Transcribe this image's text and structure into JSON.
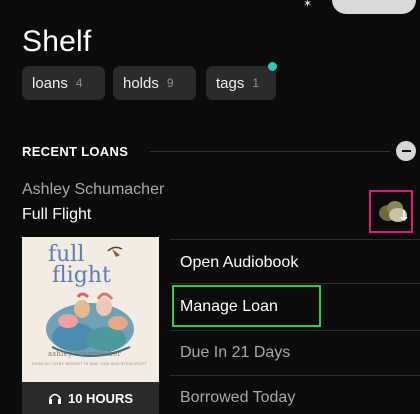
{
  "page": {
    "title": "Shelf"
  },
  "filters": [
    {
      "label": "loans",
      "count": "4"
    },
    {
      "label": "holds",
      "count": "9"
    },
    {
      "label": "tags",
      "count": "1"
    }
  ],
  "section": {
    "header": "RECENT LOANS"
  },
  "loan": {
    "author": "Ashley Schumacher",
    "title": "Full Flight",
    "cover": {
      "title_line1": "full",
      "title_line2": "flight",
      "author": "ashley schumacher",
      "credit": "READ BY COBY BENNETTS AND TINA WOLSTENCROFT"
    },
    "duration": "10 HOURS"
  },
  "menu": {
    "items": [
      "Open Audiobook",
      "Manage Loan",
      "Due In 21 Days",
      "Borrowed Today"
    ]
  },
  "colors": {
    "highlight_download": "#e0197d",
    "highlight_manage": "#1fd24a",
    "tag_dot": "#37c4b8"
  },
  "icons": {
    "download": "cloud-download-icon",
    "collapse": "minus-circle-icon",
    "audiobook": "headphones-icon"
  }
}
